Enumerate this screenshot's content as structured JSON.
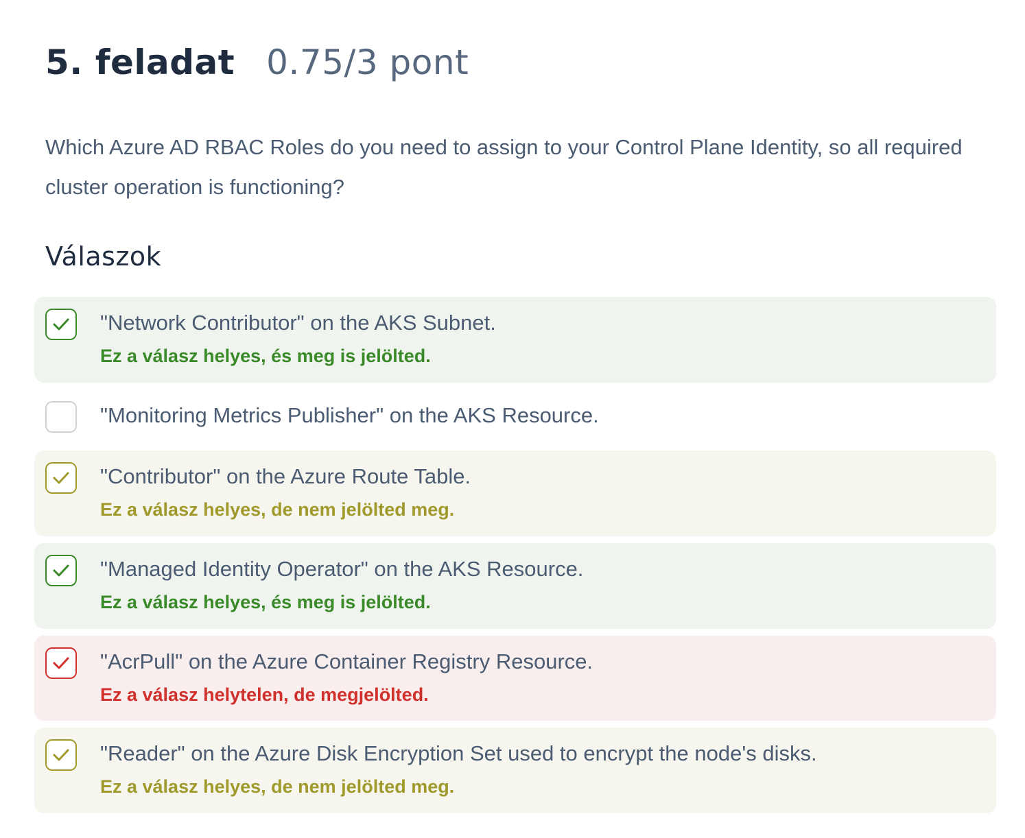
{
  "header": {
    "title": "5. feladat",
    "score": "0.75/3 pont"
  },
  "question": {
    "text": "Which Azure AD RBAC Roles do you need to assign to your Control Plane Identity, so all required cluster operation is functioning?"
  },
  "answers_section": {
    "heading": "Válaszok"
  },
  "colors": {
    "correct_checked_green": "#3b8a2a",
    "correct_missed_olive": "#a09a2c",
    "wrong_checked_red": "#d0312d",
    "neutral_border": "#cfd3d8"
  },
  "answers": [
    {
      "text": "\"Network Contributor\" on the AKS Subnet.",
      "feedback": "Ez a válasz helyes, és meg is jelölted.",
      "status": "correct-checked",
      "checkbox_icon": "check-icon"
    },
    {
      "text": "\"Monitoring Metrics Publisher\" on the AKS Resource.",
      "feedback": "",
      "status": "neutral",
      "checkbox_icon": ""
    },
    {
      "text": "\"Contributor\" on the Azure Route Table.",
      "feedback": "Ez a válasz helyes, de nem jelölted meg.",
      "status": "correct-missed",
      "checkbox_icon": "check-icon"
    },
    {
      "text": "\"Managed Identity Operator\" on the AKS Resource.",
      "feedback": "Ez a válasz helyes, és meg is jelölted.",
      "status": "correct-checked",
      "checkbox_icon": "check-icon"
    },
    {
      "text": "\"AcrPull\" on the Azure Container Registry Resource.",
      "feedback": "Ez a válasz helytelen, de megjelölted.",
      "status": "wrong-checked",
      "checkbox_icon": "check-icon"
    },
    {
      "text": "\"Reader\" on the Azure Disk Encryption Set used to encrypt the node's disks.",
      "feedback": "Ez a válasz helyes, de nem jelölted meg.",
      "status": "correct-missed",
      "checkbox_icon": "check-icon"
    }
  ]
}
